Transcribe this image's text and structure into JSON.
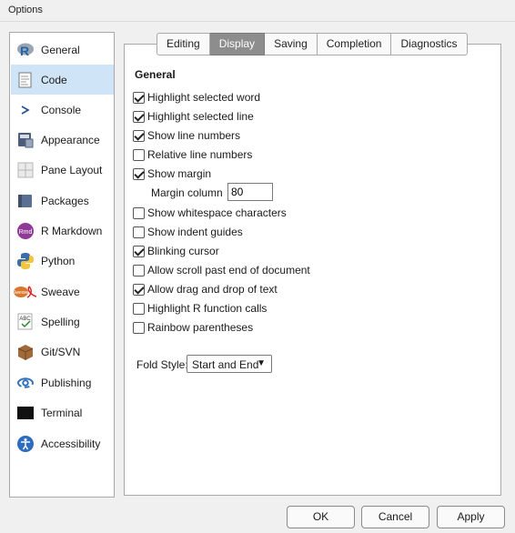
{
  "window": {
    "title": "Options"
  },
  "sidebar": {
    "items": [
      {
        "label": "General",
        "icon": "r-logo-icon"
      },
      {
        "label": "Code",
        "icon": "code-document-icon",
        "selected": true
      },
      {
        "label": "Console",
        "icon": "console-prompt-icon"
      },
      {
        "label": "Appearance",
        "icon": "appearance-icon"
      },
      {
        "label": "Pane Layout",
        "icon": "pane-layout-icon"
      },
      {
        "label": "Packages",
        "icon": "packages-icon"
      },
      {
        "label": "R Markdown",
        "icon": "rmarkdown-icon",
        "icon_text": "Rmd"
      },
      {
        "label": "Python",
        "icon": "python-icon"
      },
      {
        "label": "Sweave",
        "icon": "sweave-pdf-icon",
        "icon_text": "Sweave"
      },
      {
        "label": "Spelling",
        "icon": "spelling-icon",
        "icon_text": "ABC"
      },
      {
        "label": "Git/SVN",
        "icon": "git-svn-box-icon"
      },
      {
        "label": "Publishing",
        "icon": "publishing-icon"
      },
      {
        "label": "Terminal",
        "icon": "terminal-icon"
      },
      {
        "label": "Accessibility",
        "icon": "accessibility-icon"
      }
    ]
  },
  "tabs": [
    {
      "label": "Editing"
    },
    {
      "label": "Display",
      "active": true
    },
    {
      "label": "Saving"
    },
    {
      "label": "Completion"
    },
    {
      "label": "Diagnostics"
    }
  ],
  "display": {
    "section_title": "General",
    "options": [
      {
        "label": "Highlight selected word",
        "checked": true
      },
      {
        "label": "Highlight selected line",
        "checked": true
      },
      {
        "label": "Show line numbers",
        "checked": true
      },
      {
        "label": "Relative line numbers",
        "checked": false
      },
      {
        "label": "Show margin",
        "checked": true
      },
      {
        "label": "Show whitespace characters",
        "checked": false
      },
      {
        "label": "Show indent guides",
        "checked": false
      },
      {
        "label": "Blinking cursor",
        "checked": true
      },
      {
        "label": "Allow scroll past end of document",
        "checked": false
      },
      {
        "label": "Allow drag and drop of text",
        "checked": true
      },
      {
        "label": "Highlight R function calls",
        "checked": false
      },
      {
        "label": "Rainbow parentheses",
        "checked": false
      }
    ],
    "margin_column": {
      "label": "Margin column",
      "value": "80"
    },
    "fold_style": {
      "label": "Fold Style:",
      "value": "Start and End"
    }
  },
  "buttons": {
    "ok": "OK",
    "cancel": "Cancel",
    "apply": "Apply"
  },
  "colors": {
    "selected_bg": "#cfe4f6",
    "active_tab": "#8d8d8d",
    "r_blue": "#2166ac",
    "rmd_purple": "#8e3a96"
  }
}
